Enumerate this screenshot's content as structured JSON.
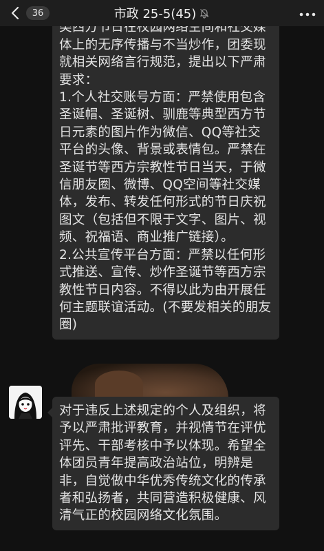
{
  "header": {
    "back_count": "36",
    "title": "市政 25-5(45)",
    "icons": {
      "back": "chevron-left-icon",
      "mute": "bell-muted-icon",
      "more": "more-dots-icon"
    }
  },
  "messages": [
    {
      "sender": "other",
      "text": "为代现实化，坚定文化自信，在无各类西方节日在校园网络空间和社交媒体上的无序传播与不当炒作，团委现就相关网络言行规范，提出以下严肃要求：\n1.个人社交账号方面：严禁使用包含圣诞帽、圣诞树、驯鹿等典型西方节日元素的图片作为微信、QQ等社交平台的头像、背景或表情包。严禁在圣诞节等西方宗教性节日当天，于微信朋友圈、微博、QQ空间等社交媒体，发布、转发任何形式的节日庆祝图文（包括但不限于文字、图片、视频、祝福语、商业推广链接）。\n2.公共宣传平台方面：严禁以任何形式推送、宣传、炒作圣诞节等西方宗教性节日内容。不得以此为由开展任何主题联谊活动。(不要发相关的朋友圈)"
    },
    {
      "sender": "other",
      "text": "对于违反上述规定的个人及组织，将予以严肃批评教育，并视情节在评优评先、干部考核中予以体现。希望全体团员青年提高政治站位，明辨是非，自觉做中华优秀传统文化的传承者和弘扬者，共同营造积极健康、风清气正的校园网络文化氛围。"
    }
  ],
  "colors": {
    "background": "#111111",
    "topbar": "#1e1e1e",
    "bubble": "#2c2c2c",
    "text": "#e4e4e4"
  }
}
